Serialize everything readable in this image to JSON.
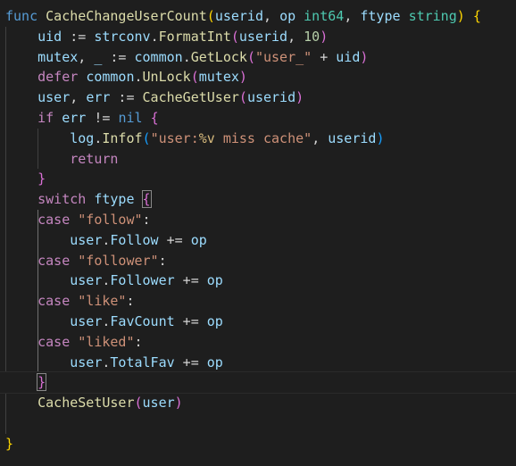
{
  "code": {
    "lines": [
      {
        "tokens": [
          [
            "kw",
            "func"
          ],
          [
            "op",
            " "
          ],
          [
            "fn",
            "CacheChangeUserCount"
          ],
          [
            "br1",
            "("
          ],
          [
            "var",
            "userid"
          ],
          [
            "op",
            ", "
          ],
          [
            "var",
            "op"
          ],
          [
            "op",
            " "
          ],
          [
            "typ",
            "int64"
          ],
          [
            "op",
            ", "
          ],
          [
            "var",
            "ftype"
          ],
          [
            "op",
            " "
          ],
          [
            "typ",
            "string"
          ],
          [
            "br1",
            ")"
          ],
          [
            "op",
            " "
          ],
          [
            "br1",
            "{"
          ]
        ]
      },
      {
        "tokens": [
          [
            "op",
            "    "
          ],
          [
            "var",
            "uid"
          ],
          [
            "op",
            " := "
          ],
          [
            "var",
            "strconv"
          ],
          [
            "op",
            "."
          ],
          [
            "fn",
            "FormatInt"
          ],
          [
            "br2",
            "("
          ],
          [
            "var",
            "userid"
          ],
          [
            "op",
            ", "
          ],
          [
            "num",
            "10"
          ],
          [
            "br2",
            ")"
          ]
        ]
      },
      {
        "tokens": [
          [
            "op",
            "    "
          ],
          [
            "var",
            "mutex"
          ],
          [
            "op",
            ", "
          ],
          [
            "var",
            "_"
          ],
          [
            "op",
            " := "
          ],
          [
            "var",
            "common"
          ],
          [
            "op",
            "."
          ],
          [
            "fn",
            "GetLock"
          ],
          [
            "br2",
            "("
          ],
          [
            "str",
            "\"user_\""
          ],
          [
            "op",
            " + "
          ],
          [
            "var",
            "uid"
          ],
          [
            "br2",
            ")"
          ]
        ]
      },
      {
        "tokens": [
          [
            "op",
            "    "
          ],
          [
            "ctl",
            "defer"
          ],
          [
            "op",
            " "
          ],
          [
            "var",
            "common"
          ],
          [
            "op",
            "."
          ],
          [
            "fn",
            "UnLock"
          ],
          [
            "br2",
            "("
          ],
          [
            "var",
            "mutex"
          ],
          [
            "br2",
            ")"
          ]
        ]
      },
      {
        "tokens": [
          [
            "op",
            "    "
          ],
          [
            "var",
            "user"
          ],
          [
            "op",
            ", "
          ],
          [
            "var",
            "err"
          ],
          [
            "op",
            " := "
          ],
          [
            "fn",
            "CacheGetUser"
          ],
          [
            "br2",
            "("
          ],
          [
            "var",
            "userid"
          ],
          [
            "br2",
            ")"
          ]
        ]
      },
      {
        "tokens": [
          [
            "op",
            "    "
          ],
          [
            "ctl",
            "if"
          ],
          [
            "op",
            " "
          ],
          [
            "var",
            "err"
          ],
          [
            "op",
            " != "
          ],
          [
            "kw",
            "nil"
          ],
          [
            "op",
            " "
          ],
          [
            "br2",
            "{"
          ]
        ]
      },
      {
        "tokens": [
          [
            "op",
            "        "
          ],
          [
            "var",
            "log"
          ],
          [
            "op",
            "."
          ],
          [
            "fn",
            "Infof"
          ],
          [
            "br3",
            "("
          ],
          [
            "str",
            "\"user:"
          ],
          [
            "esc",
            "%v"
          ],
          [
            "str",
            " miss cache\""
          ],
          [
            "op",
            ", "
          ],
          [
            "var",
            "userid"
          ],
          [
            "br3",
            ")"
          ]
        ]
      },
      {
        "tokens": [
          [
            "op",
            "        "
          ],
          [
            "ctl",
            "return"
          ]
        ]
      },
      {
        "tokens": [
          [
            "op",
            "    "
          ],
          [
            "br2",
            "}"
          ]
        ]
      },
      {
        "tokens": [
          [
            "op",
            "    "
          ],
          [
            "ctl",
            "switch"
          ],
          [
            "op",
            " "
          ],
          [
            "var",
            "ftype"
          ],
          [
            "op",
            " "
          ],
          [
            "br2m",
            "{"
          ]
        ]
      },
      {
        "tokens": [
          [
            "op",
            "    "
          ],
          [
            "ctl",
            "case"
          ],
          [
            "op",
            " "
          ],
          [
            "str",
            "\"follow\""
          ],
          [
            "op",
            ":"
          ]
        ]
      },
      {
        "tokens": [
          [
            "op",
            "        "
          ],
          [
            "var",
            "user"
          ],
          [
            "op",
            "."
          ],
          [
            "var",
            "Follow"
          ],
          [
            "op",
            " += "
          ],
          [
            "var",
            "op"
          ]
        ]
      },
      {
        "tokens": [
          [
            "op",
            "    "
          ],
          [
            "ctl",
            "case"
          ],
          [
            "op",
            " "
          ],
          [
            "str",
            "\"follower\""
          ],
          [
            "op",
            ":"
          ]
        ]
      },
      {
        "tokens": [
          [
            "op",
            "        "
          ],
          [
            "var",
            "user"
          ],
          [
            "op",
            "."
          ],
          [
            "var",
            "Follower"
          ],
          [
            "op",
            " += "
          ],
          [
            "var",
            "op"
          ]
        ]
      },
      {
        "tokens": [
          [
            "op",
            "    "
          ],
          [
            "ctl",
            "case"
          ],
          [
            "op",
            " "
          ],
          [
            "str",
            "\"like\""
          ],
          [
            "op",
            ":"
          ]
        ]
      },
      {
        "tokens": [
          [
            "op",
            "        "
          ],
          [
            "var",
            "user"
          ],
          [
            "op",
            "."
          ],
          [
            "var",
            "FavCount"
          ],
          [
            "op",
            " += "
          ],
          [
            "var",
            "op"
          ]
        ]
      },
      {
        "tokens": [
          [
            "op",
            "    "
          ],
          [
            "ctl",
            "case"
          ],
          [
            "op",
            " "
          ],
          [
            "str",
            "\"liked\""
          ],
          [
            "op",
            ":"
          ]
        ]
      },
      {
        "tokens": [
          [
            "op",
            "        "
          ],
          [
            "var",
            "user"
          ],
          [
            "op",
            "."
          ],
          [
            "var",
            "TotalFav"
          ],
          [
            "op",
            " += "
          ],
          [
            "var",
            "op"
          ]
        ]
      },
      {
        "tokens": [
          [
            "op",
            "    "
          ],
          [
            "br2m",
            "}"
          ],
          [
            "cursor",
            ""
          ]
        ]
      },
      {
        "tokens": [
          [
            "op",
            "    "
          ],
          [
            "fn",
            "CacheSetUser"
          ],
          [
            "br2",
            "("
          ],
          [
            "var",
            "user"
          ],
          [
            "br2",
            ")"
          ]
        ]
      },
      {
        "tokens": []
      },
      {
        "tokens": [
          [
            "br1",
            "}"
          ]
        ]
      }
    ]
  }
}
